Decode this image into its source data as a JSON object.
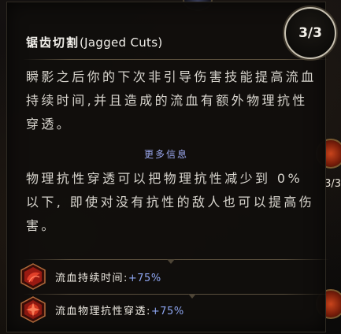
{
  "skill": {
    "title_cn": "锯齿切割",
    "title_en": "(Jagged Cuts)",
    "rank": "3/3"
  },
  "description": {
    "main": "瞬影之后你的下次非引导伤害技能提高流血持续时间,并且造成的流血有额外物理抗性穿透。",
    "more_info_label": "更多信息",
    "extra": "物理抗性穿透可以把物理抗性减少到 0% 以下, 即使对没有抗性的敌人也可以提高伤害。"
  },
  "stats": [
    {
      "label": "流血持续时间:",
      "value": "+75%",
      "icon": "bleed-duration-icon"
    },
    {
      "label": "流血物理抗性穿透:",
      "value": "+75%",
      "icon": "physical-penetration-icon"
    }
  ],
  "background": {
    "side_rank": "3/3"
  },
  "colors": {
    "title": "#f1efea",
    "text": "#d9d6cf",
    "more_info": "#9aa7ee",
    "stat_value": "#8ea6f2",
    "icon_red": "#c0241a"
  }
}
